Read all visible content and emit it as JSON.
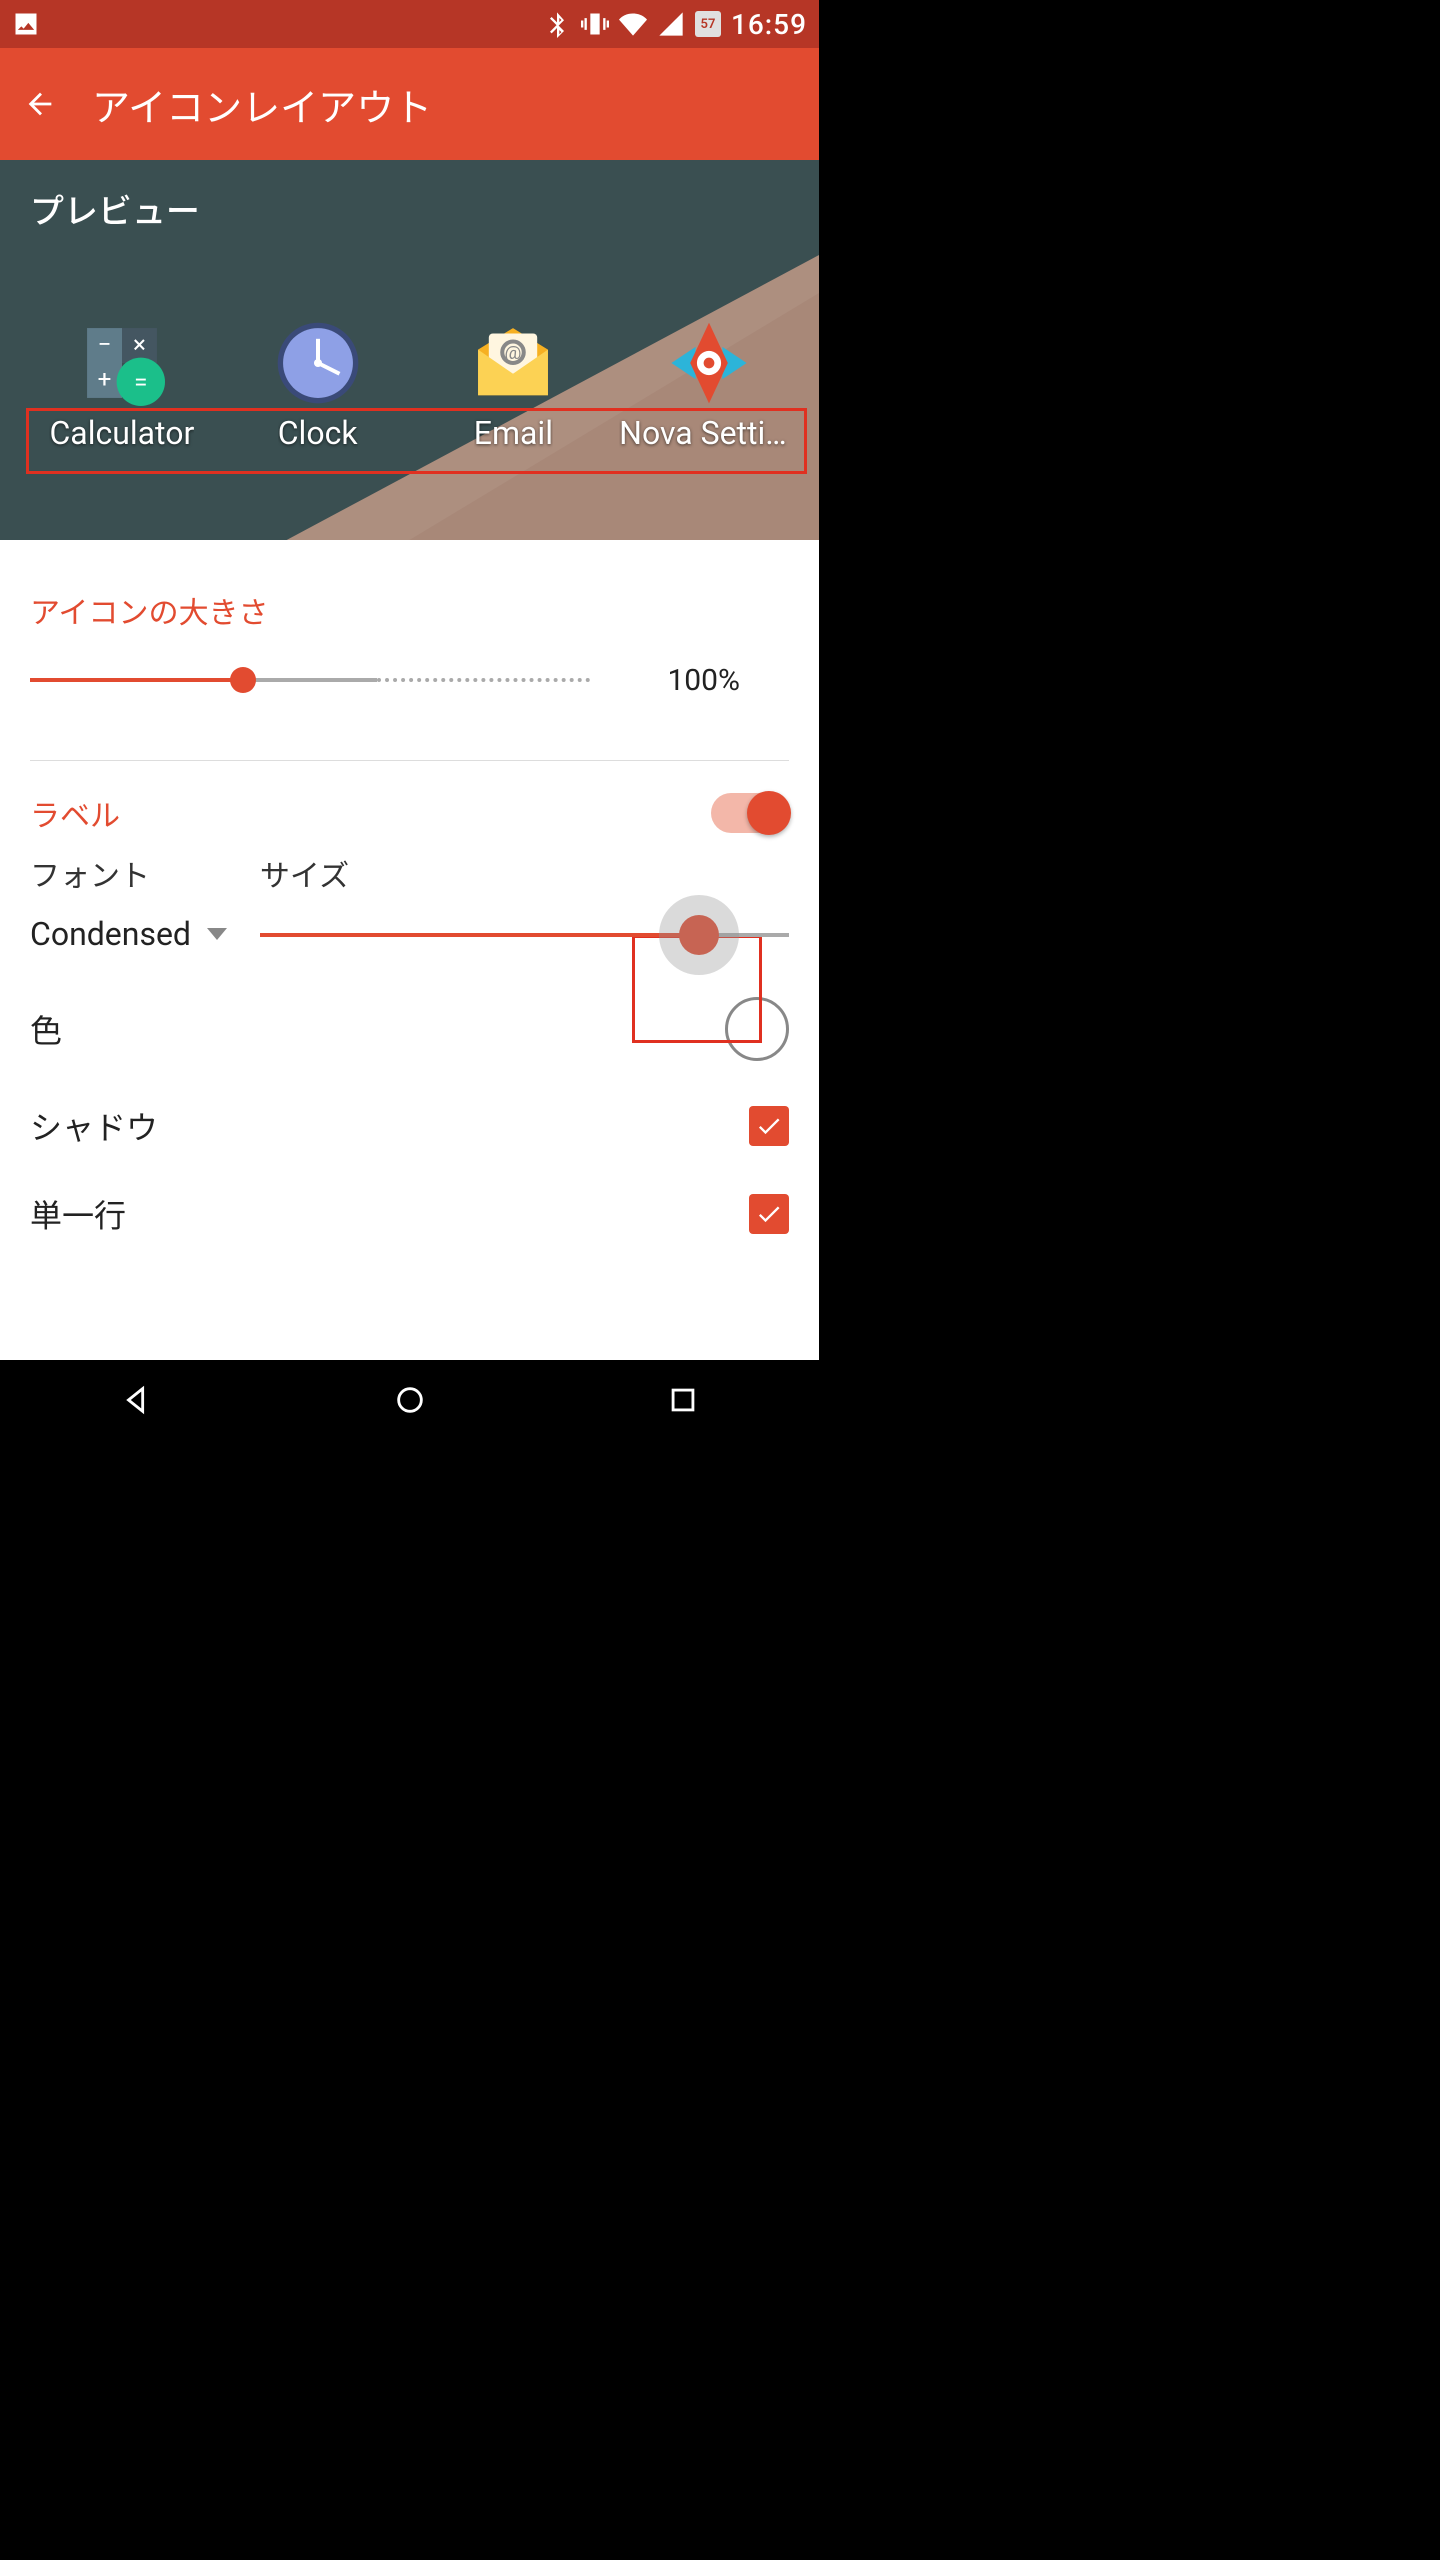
{
  "statusbar": {
    "time": "16:59",
    "battery_pct": "57"
  },
  "appbar": {
    "title": "アイコンレイアウト"
  },
  "preview": {
    "label": "プレビュー",
    "apps": [
      {
        "name": "Calculator"
      },
      {
        "name": "Clock"
      },
      {
        "name": "Email"
      },
      {
        "name": "Nova Settin…"
      }
    ]
  },
  "settings": {
    "icon_size": {
      "title": "アイコンの大きさ",
      "value_pct": "100%",
      "slider_pos": 0.38,
      "dotted_from": 0.62
    },
    "label_section": {
      "title": "ラベル",
      "toggle_on": true,
      "font_label": "フォント",
      "size_label": "サイズ",
      "font_value": "Condensed",
      "size_slider_pos": 0.83,
      "color_label": "色",
      "shadow_label": "シャドウ",
      "shadow_checked": true,
      "singleline_label": "単一行",
      "singleline_checked": true
    }
  },
  "colors": {
    "accent": "#e24b30",
    "statusbar": "#b63626"
  }
}
